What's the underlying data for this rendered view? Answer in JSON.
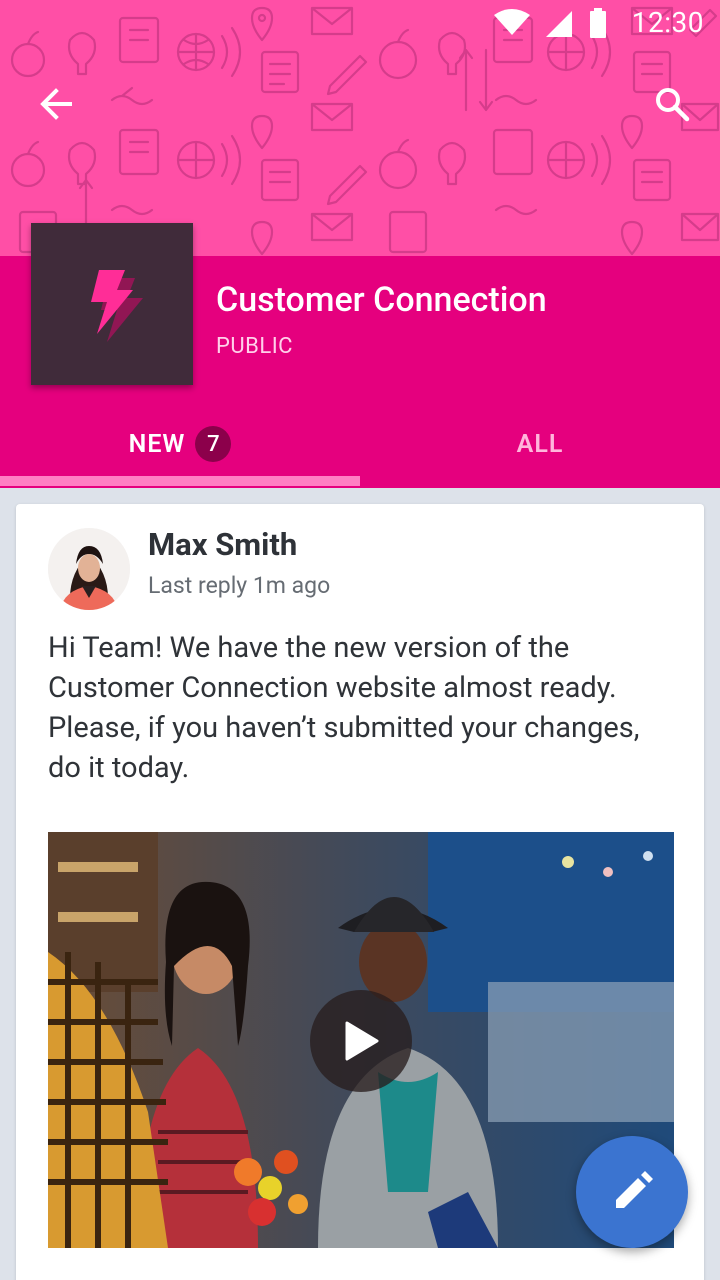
{
  "status": {
    "time": "12:30",
    "icons": [
      "wifi-icon",
      "cellular-icon",
      "battery-icon"
    ]
  },
  "toolbar": {
    "back_icon": "arrow-back-icon",
    "search_icon": "search-icon"
  },
  "group": {
    "title": "Customer Connection",
    "visibility": "PUBLIC",
    "logo_icon": "lightning-bolt-icon"
  },
  "tabs": {
    "new_label": "NEW",
    "new_count": "7",
    "all_label": "ALL"
  },
  "post": {
    "author": "Max Smith",
    "meta": "Last reply 1m ago",
    "body": "Hi Team! We have the new version of the Customer Connection website almost ready. Please, if you haven’t submitted your changes, do it today."
  },
  "fab_icon": "edit-pencil-icon",
  "colors": {
    "hero": "#ff4fa6",
    "band": "#e5007e",
    "badge": "#8c004b",
    "fab": "#3b74d0"
  }
}
